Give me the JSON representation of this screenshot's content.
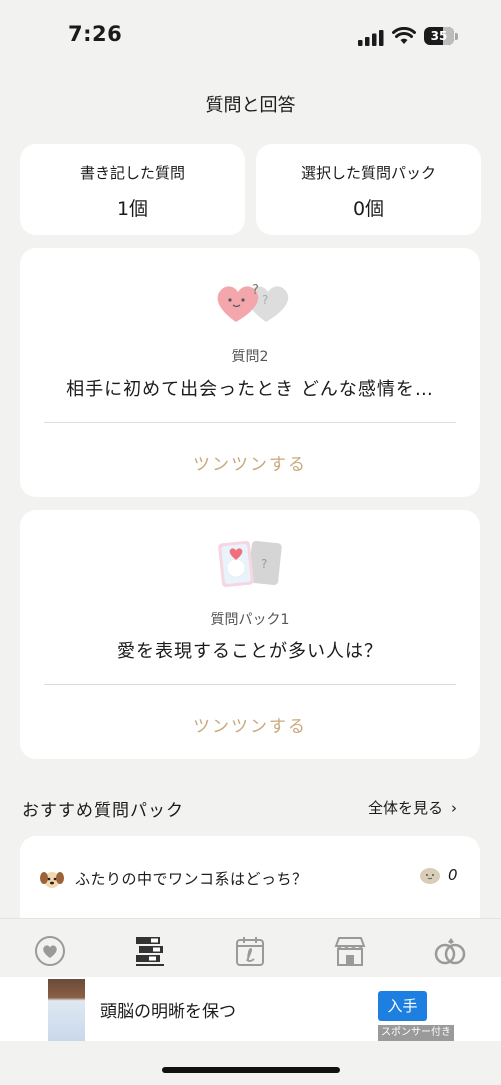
{
  "status": {
    "time": "7:26",
    "battery": "35"
  },
  "header": {
    "title": "質問と回答"
  },
  "stats": [
    {
      "label": "書き記した質問",
      "value": "1個"
    },
    {
      "label": "選択した質問パック",
      "value": "0個"
    }
  ],
  "question_card": {
    "label": "質問2",
    "text": "相手に初めて出会ったとき どんな感情を…",
    "action": "ツンツンする"
  },
  "pack_card": {
    "label": "質問パック1",
    "text": "愛を表現することが多い人は？",
    "action": "ツンツンする"
  },
  "recommend": {
    "title": "おすすめ質問パック",
    "see_all": "全体を見る",
    "item": {
      "text": "ふたりの中でワンコ系はどっち？",
      "count": "0"
    }
  },
  "tabs": [
    {
      "name": "home",
      "icon": "heart-circle-icon"
    },
    {
      "name": "questions",
      "icon": "books-icon",
      "active": true
    },
    {
      "name": "calendar",
      "icon": "calendar-icon"
    },
    {
      "name": "store",
      "icon": "store-icon"
    },
    {
      "name": "couple",
      "icon": "rings-icon"
    }
  ],
  "ad": {
    "text": "頭脳の明晰を保つ",
    "button": "入手",
    "sponsor": "スポンサー付き"
  },
  "colors": {
    "accent": "#c9a97d",
    "background": "#f2f2f1",
    "ad_button": "#1d7fe0"
  }
}
